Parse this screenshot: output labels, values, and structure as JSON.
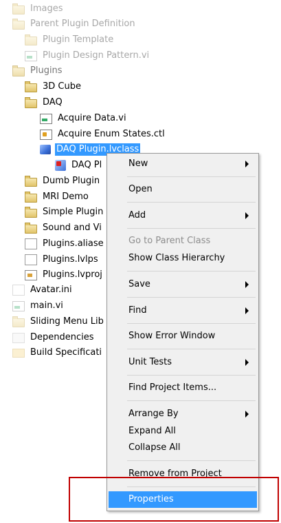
{
  "tree": {
    "images": "Images",
    "parent_plugin_definition": "Parent Plugin Definition",
    "plugin_template": "Plugin Template",
    "plugin_design_pattern": "Plugin Design Pattern.vi",
    "plugins": "Plugins",
    "cube_3d": "3D Cube",
    "daq": "DAQ",
    "acquire_data": "Acquire Data.vi",
    "acquire_enum_states": "Acquire Enum States.ctl",
    "daq_plugin_lvclass": "DAQ Plugin.lvclass",
    "daq_plugin_child": "DAQ Pl",
    "dumb_plugin": "Dumb Plugin",
    "mri_demo": "MRI Demo",
    "simple_plugin": "Simple Plugin",
    "sound_and_vi": "Sound and Vi",
    "plugins_aliases": "Plugins.aliase",
    "plugins_lvlps": "Plugins.lvlps",
    "plugins_lvproj": "Plugins.lvproj",
    "avatar_ini": "Avatar.ini",
    "main_vi": "main.vi",
    "sliding_menu": "Sliding Menu Lib",
    "dependencies": "Dependencies",
    "build_specifications": "Build Specificati"
  },
  "context_menu": {
    "new": "New",
    "open": "Open",
    "add": "Add",
    "go_to_parent_class": "Go to Parent Class",
    "show_class_hierarchy": "Show Class Hierarchy",
    "save": "Save",
    "find": "Find",
    "show_error_window": "Show Error Window",
    "unit_tests": "Unit Tests",
    "find_project_items": "Find Project Items...",
    "arrange_by": "Arrange By",
    "expand_all": "Expand All",
    "collapse_all": "Collapse All",
    "remove_from_project": "Remove from Project",
    "properties": "Properties"
  },
  "colors": {
    "selection": "#3399ff",
    "menu_background": "#f0f0f0",
    "highlight_box": "#c00000"
  },
  "icons": {
    "folder": "folder-icon",
    "vi": "vi-file-icon",
    "ctl": "control-file-icon",
    "class": "lvclass-cube-icon",
    "submenu": "submenu-arrow-icon"
  }
}
